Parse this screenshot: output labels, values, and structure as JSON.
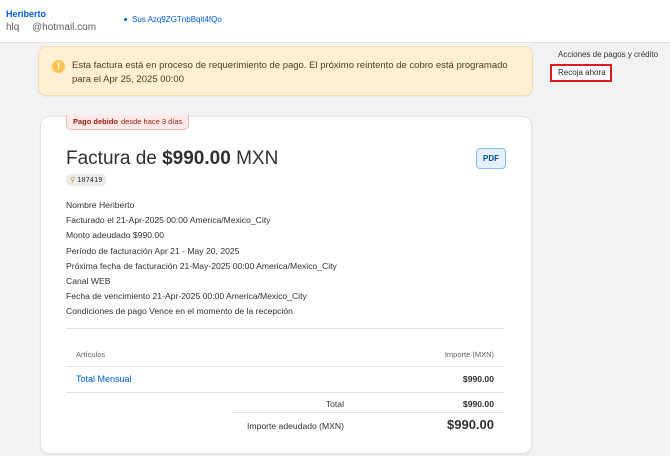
{
  "customer": {
    "name": "Heriberto",
    "id": "hlq",
    "email": "@hotmail.com",
    "subscription_link": "Sus Azq9ZGTnbBqit4fQo"
  },
  "banner": {
    "icon": "warning-icon",
    "text": "Esta factura está en proceso de requerimiento de pago. El próximo reintento de cobro está programado para el Apr 25, 2025 00:00"
  },
  "sidebar": {
    "title": "Acciones de pagos y crédito",
    "collect_button": "Recoja ahora"
  },
  "invoice": {
    "status_label": "Pago debido",
    "status_since": "desde hace 3 días",
    "title_prefix": "Factura de",
    "amount": "$990.00",
    "currency": "MXN",
    "pdf_label": "PDF",
    "order_number": "107419",
    "details": [
      {
        "label": "Nombre",
        "value": "Heriberto"
      },
      {
        "label": "Facturado el",
        "value": "21-Apr-2025 00:00 America/Mexico_City"
      },
      {
        "label": "Monto adeudado",
        "value": "$990.00"
      },
      {
        "label": "Período de facturación",
        "value": "Apr 21 - May 20, 2025"
      },
      {
        "label": "Próxima fecha de facturación",
        "value": "21-May-2025 00:00 America/Mexico_City"
      },
      {
        "label": "Canal",
        "value": "WEB"
      },
      {
        "label": "Fecha de vencimiento",
        "value": "21-Apr-2025 00:00 America/Mexico_City"
      },
      {
        "label": "Condiciones de pago",
        "value": "Vence en el momento de la recepción"
      }
    ],
    "table": {
      "col_items": "Artículos",
      "col_amount": "Importe (MXN)",
      "rows": [
        {
          "item": "Total Mensual",
          "amount": "$990.00"
        }
      ],
      "total_label": "Total",
      "total_value": "$990.00",
      "due_label": "Importe adeudado (MXN)",
      "due_value": "$990.00"
    }
  },
  "colors": {
    "link": "#005bd3",
    "banner_bg": "#fcefd2",
    "highlight_border": "#e0181f",
    "badge_bg": "#ffe9e8"
  }
}
